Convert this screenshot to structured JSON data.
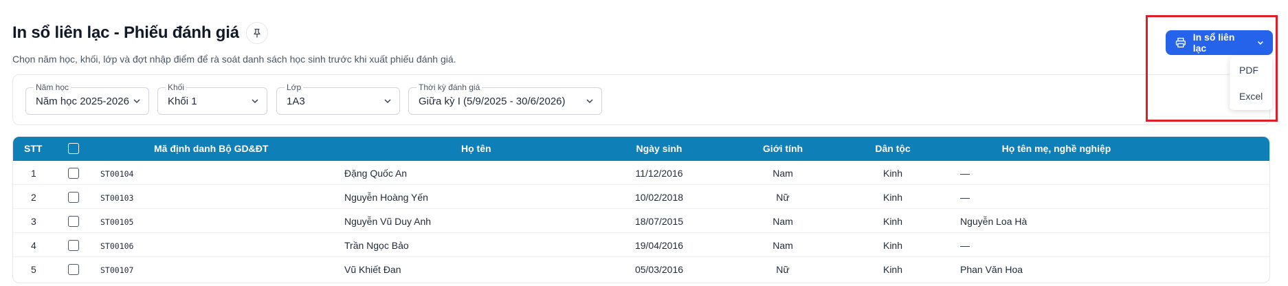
{
  "header": {
    "title": "In sổ liên lạc - Phiếu đánh giá",
    "subtitle": "Chọn năm học, khối, lớp và đợt nhập điểm để rà soát danh sách học sinh trước khi xuất phiếu đánh giá."
  },
  "filters": {
    "year": {
      "label": "Năm học",
      "value": "Năm học 2025-2026"
    },
    "grade": {
      "label": "Khối",
      "value": "Khối 1"
    },
    "class": {
      "label": "Lớp",
      "value": "1A3"
    },
    "period": {
      "label": "Thời kỳ đánh giá",
      "value": "Giữa kỳ I (5/9/2025 - 30/6/2026)"
    }
  },
  "table": {
    "headers": {
      "stt": "STT",
      "code": "Mã định danh Bộ GD&ĐT",
      "name": "Họ tên",
      "dob": "Ngày sinh",
      "gender": "Giới tính",
      "ethnicity": "Dân tộc",
      "mother": "Họ tên mẹ, nghề nghiệp"
    },
    "rows": [
      {
        "stt": "1",
        "code": "ST00104",
        "name": "Đặng Quốc An",
        "dob": "11/12/2016",
        "gender": "Nam",
        "ethnicity": "Kinh",
        "mother": "—"
      },
      {
        "stt": "2",
        "code": "ST00103",
        "name": "Nguyễn Hoàng Yến",
        "dob": "10/02/2018",
        "gender": "Nữ",
        "ethnicity": "Kinh",
        "mother": "—"
      },
      {
        "stt": "3",
        "code": "ST00105",
        "name": "Nguyễn Vũ Duy Anh",
        "dob": "18/07/2015",
        "gender": "Nam",
        "ethnicity": "Kinh",
        "mother": "Nguyễn Loa Hà"
      },
      {
        "stt": "4",
        "code": "ST00106",
        "name": "Trần Ngọc Bảo",
        "dob": "19/04/2016",
        "gender": "Nam",
        "ethnicity": "Kinh",
        "mother": "—"
      },
      {
        "stt": "5",
        "code": "ST00107",
        "name": "Vũ Khiết Đan",
        "dob": "05/03/2016",
        "gender": "Nữ",
        "ethnicity": "Kinh",
        "mother": "Phan Văn Hoa"
      }
    ]
  },
  "actions": {
    "print_label": "In sổ liên lạc",
    "menu": [
      "PDF",
      "Excel"
    ]
  },
  "colors": {
    "header_bg": "#0f7fb8",
    "primary_button": "#2563eb",
    "highlight": "#e11d2a"
  },
  "icons": {
    "pin": "pin-icon",
    "print": "printer-icon",
    "chevron": "chevron-down-icon"
  }
}
